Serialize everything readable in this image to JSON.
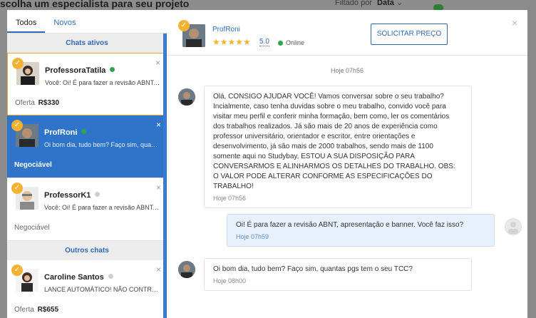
{
  "background": {
    "title": "scolha um especialista para seu projeto",
    "filter_label": "Filtado por",
    "filter_value": "Data"
  },
  "left": {
    "tabs": [
      {
        "label": "Todos",
        "active": true
      },
      {
        "label": "Novos",
        "active": false
      }
    ],
    "sections": [
      {
        "title": "Chats ativos",
        "chats": [
          {
            "name": "ProfessoraTatila",
            "online": true,
            "snippet": "Você: Oi! É para fazer a revisão ABNT, ...",
            "offer_label": "Oferta",
            "offer_value": "R$330",
            "highlight": true,
            "active": false
          },
          {
            "name": "ProfRoni",
            "online": true,
            "snippet": "Oi bom dia, tudo bem? Faço sim, quan...",
            "offer_label": "Negociável",
            "offer_value": "",
            "highlight": false,
            "active": true
          },
          {
            "name": "ProfessorK1",
            "online": false,
            "snippet": "Você: Oi! É para fazer a revisão ABNT, ...",
            "offer_label": "Negociável",
            "offer_value": "",
            "highlight": false,
            "active": false
          }
        ]
      },
      {
        "title": "Outros chats",
        "chats": [
          {
            "name": "Caroline Santos",
            "online": false,
            "snippet": "LANCE AUTOMÁTICO! NÃO CONTRAT...",
            "offer_label": "Oferta",
            "offer_value": "R$655",
            "highlight": false,
            "active": false
          }
        ]
      }
    ]
  },
  "right": {
    "expert_name": "ProfRoni",
    "stars": "★★★★★",
    "rating": "5.0",
    "status": "Online",
    "request_price_button": "SOLICITAR PREÇO",
    "close_icon": "×",
    "date_separator": "Hoje 07h56",
    "messages": [
      {
        "from": "expert",
        "text": "Olá, CONSIGO AJUDAR VOCÊ! Vamos conversar sobre o seu trabalho? Incialmente, caso tenha duvidas sobre o meu trabalho, convido você para visitar meu perfil e conferir minha formação, bem como, ler os comentários dos trabalhos realizados. Já são mais de 20 anos de experiência como professor universitário, orientador e escritor, entre orientações e desenvolvimento, já são mais de 2000 trabalhos, sendo mais de 1100 somente aqui no Studybay, ESTOU A SUA DISPOSIÇÃO PARA CONVERSARMOS E ALINHARMOS OS DETALHES DO TRABALHO. OBS: O VALOR PODE ALTERAR CONFORME AS ESPECIFICAÇÕES DO TRABALHO!",
        "time": "Hoje 07h56"
      },
      {
        "from": "me",
        "text": "Oi! É para fazer a revisão ABNT, apresentação e banner. Você faz isso?",
        "time": "Hoje 07h59"
      },
      {
        "from": "expert",
        "text": "Oi bom dia, tudo bem? Faço sim, quantas pgs tem o seu TCC?",
        "time": "Hoje 08h00"
      }
    ]
  },
  "colors": {
    "accent": "#2e74c9",
    "badge": "#f2b233",
    "online": "#2ea44f"
  },
  "icons": {
    "badge": "verified-badge-icon",
    "close": "close-icon",
    "status": "online-status-icon"
  }
}
